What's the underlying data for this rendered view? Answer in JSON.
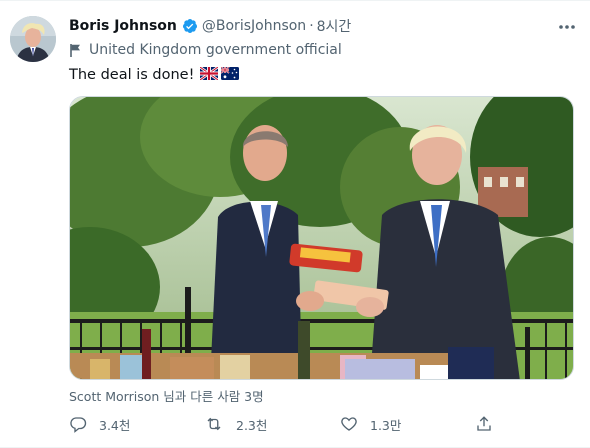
{
  "tweet": {
    "display_name": "Boris Johnson",
    "handle": "@BorisJohnson",
    "separator": "·",
    "time": "8시간",
    "label": "United Kingdom government official",
    "text": "The deal is done!",
    "tagged_people": "Scott Morrison 님과 다른 사람 3명"
  },
  "icons": {
    "verified": "verified-badge-icon",
    "government": "flag-icon",
    "more": "more-icon",
    "reply": "reply-icon",
    "retweet": "retweet-icon",
    "like": "heart-icon",
    "share": "share-icon",
    "emoji_1": "uk-flag-emoji",
    "emoji_2": "australia-flag-emoji"
  },
  "actions": {
    "replies": "3.4천",
    "retweets": "2.3천",
    "likes": "1.3만"
  },
  "colors": {
    "accent": "#1d9bf0",
    "text": "#0f1419",
    "secondary_text": "#536471"
  }
}
